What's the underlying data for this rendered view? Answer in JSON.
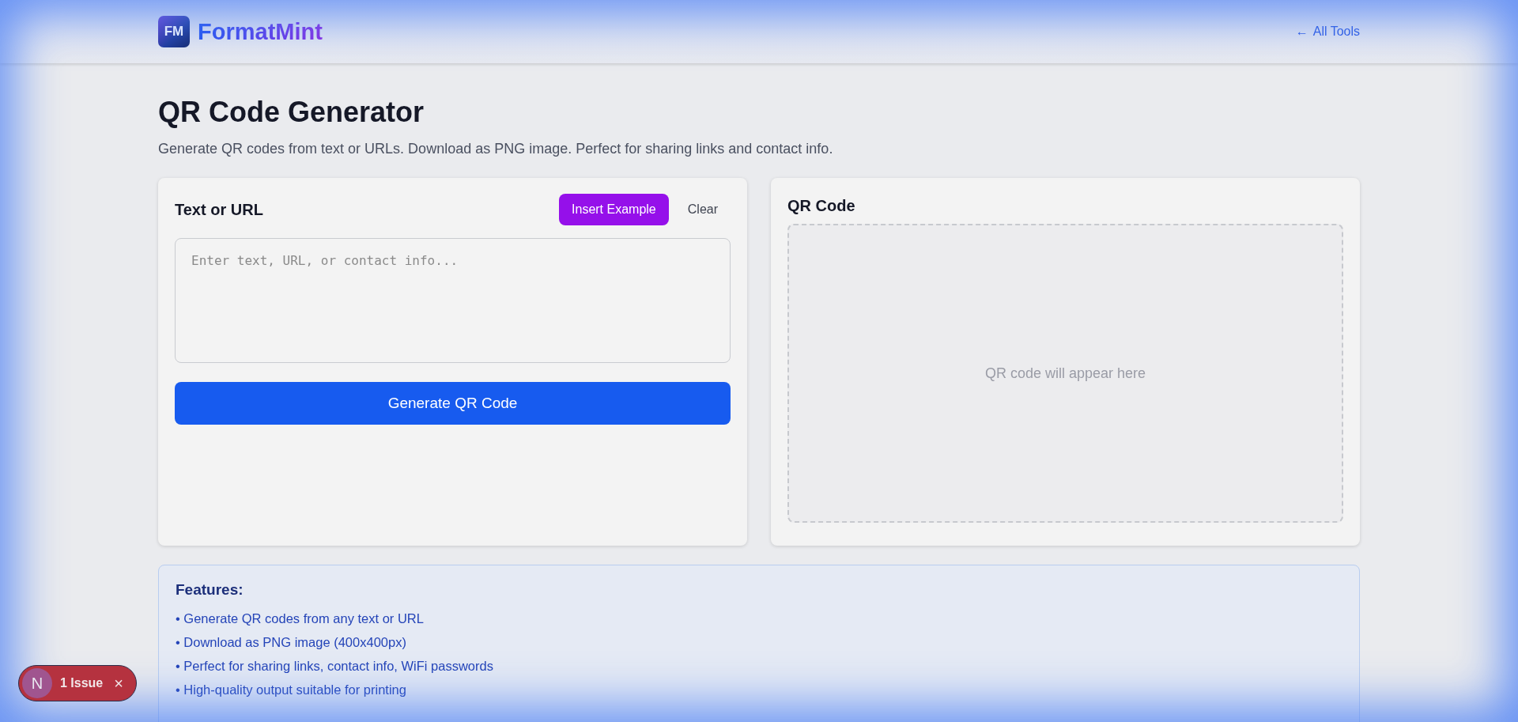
{
  "header": {
    "logo_mark": "FM",
    "brand": "FormatMint",
    "back_link": {
      "arrow": "←",
      "label": "All Tools"
    }
  },
  "page": {
    "title": "QR Code Generator",
    "subtitle": "Generate QR codes from text or URLs. Download as PNG image. Perfect for sharing links and contact info."
  },
  "input_card": {
    "title": "Text or URL",
    "buttons": [
      {
        "label": "Insert Example",
        "kind": "primary"
      },
      {
        "label": "Clear",
        "kind": "plain"
      }
    ],
    "text_area": {
      "placeholder": "Enter text, URL, or contact info..."
    },
    "generate_button": "Generate QR Code"
  },
  "output_card": {
    "title": "QR Code",
    "placeholder": "QR code will appear here"
  },
  "features": {
    "title": "Features:",
    "items": [
      "• Generate QR codes from any text or URL",
      "• Download as PNG image (400x400px)",
      "• Perfect for sharing links, contact info, WiFi passwords",
      "• High-quality output suitable for printing"
    ]
  },
  "issue_badge": {
    "logo": "N",
    "label": "1 Issue",
    "close": "×"
  }
}
